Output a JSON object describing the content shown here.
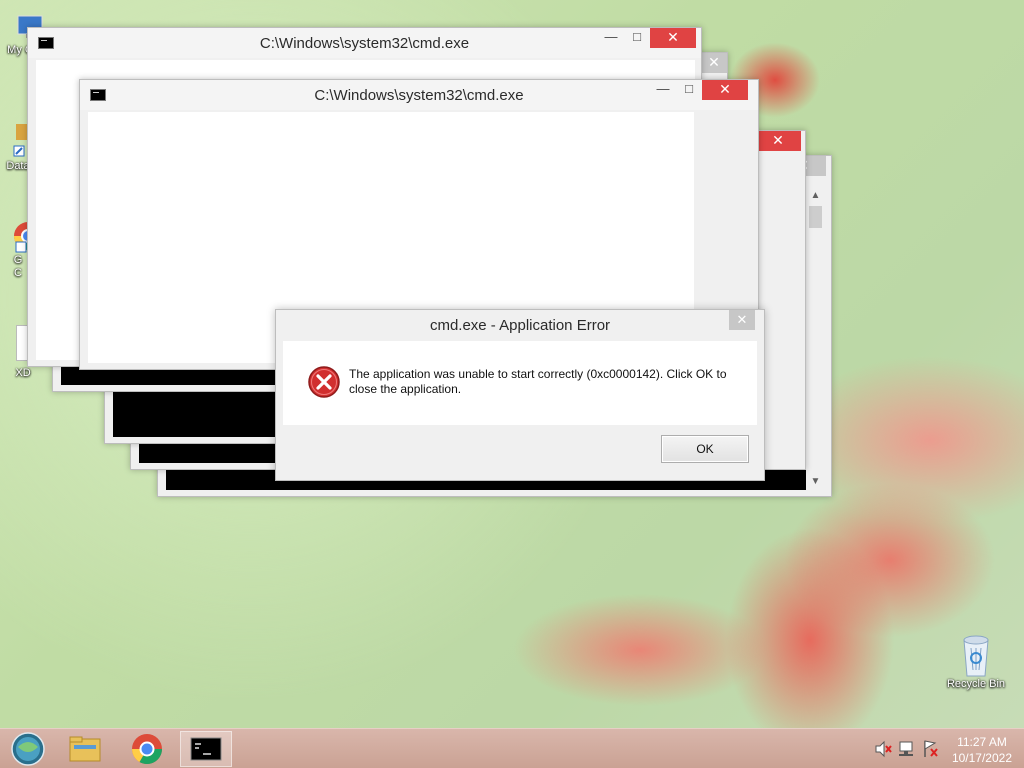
{
  "desktop": {
    "icons": [
      {
        "label": "My C"
      },
      {
        "label": "Data"
      },
      {
        "label": "G\nC"
      },
      {
        "label": "XD"
      },
      {
        "label": "Recycle Bin"
      }
    ]
  },
  "cmd_windows": [
    {
      "title": "C:\\Windows\\system32\\cmd.exe"
    },
    {
      "title": "C:\\Windows\\system32\\cmd.exe"
    }
  ],
  "window_controls": {
    "minimize": "—",
    "maximize": "□",
    "close": "✕"
  },
  "error_dialog": {
    "title": "cmd.exe - Application Error",
    "close": "✕",
    "message": "The application was unable to start correctly (0xc0000142). Click OK to close the application.",
    "ok_label": "OK"
  },
  "scrollbar": {
    "up": "▲",
    "down": "▼"
  },
  "taskbar": {
    "items": [
      {
        "icon": "start-orb-icon"
      },
      {
        "icon": "file-explorer-icon"
      },
      {
        "icon": "chrome-icon"
      },
      {
        "icon": "cmd-icon",
        "active": true
      }
    ],
    "tray_icons": [
      "volume-muted-icon",
      "network-icon",
      "action-center-flag-icon"
    ],
    "time": "11:27 AM",
    "date": "10/17/2022"
  },
  "colors": {
    "close_red": "#e04343",
    "taskbar": "#caa294"
  }
}
